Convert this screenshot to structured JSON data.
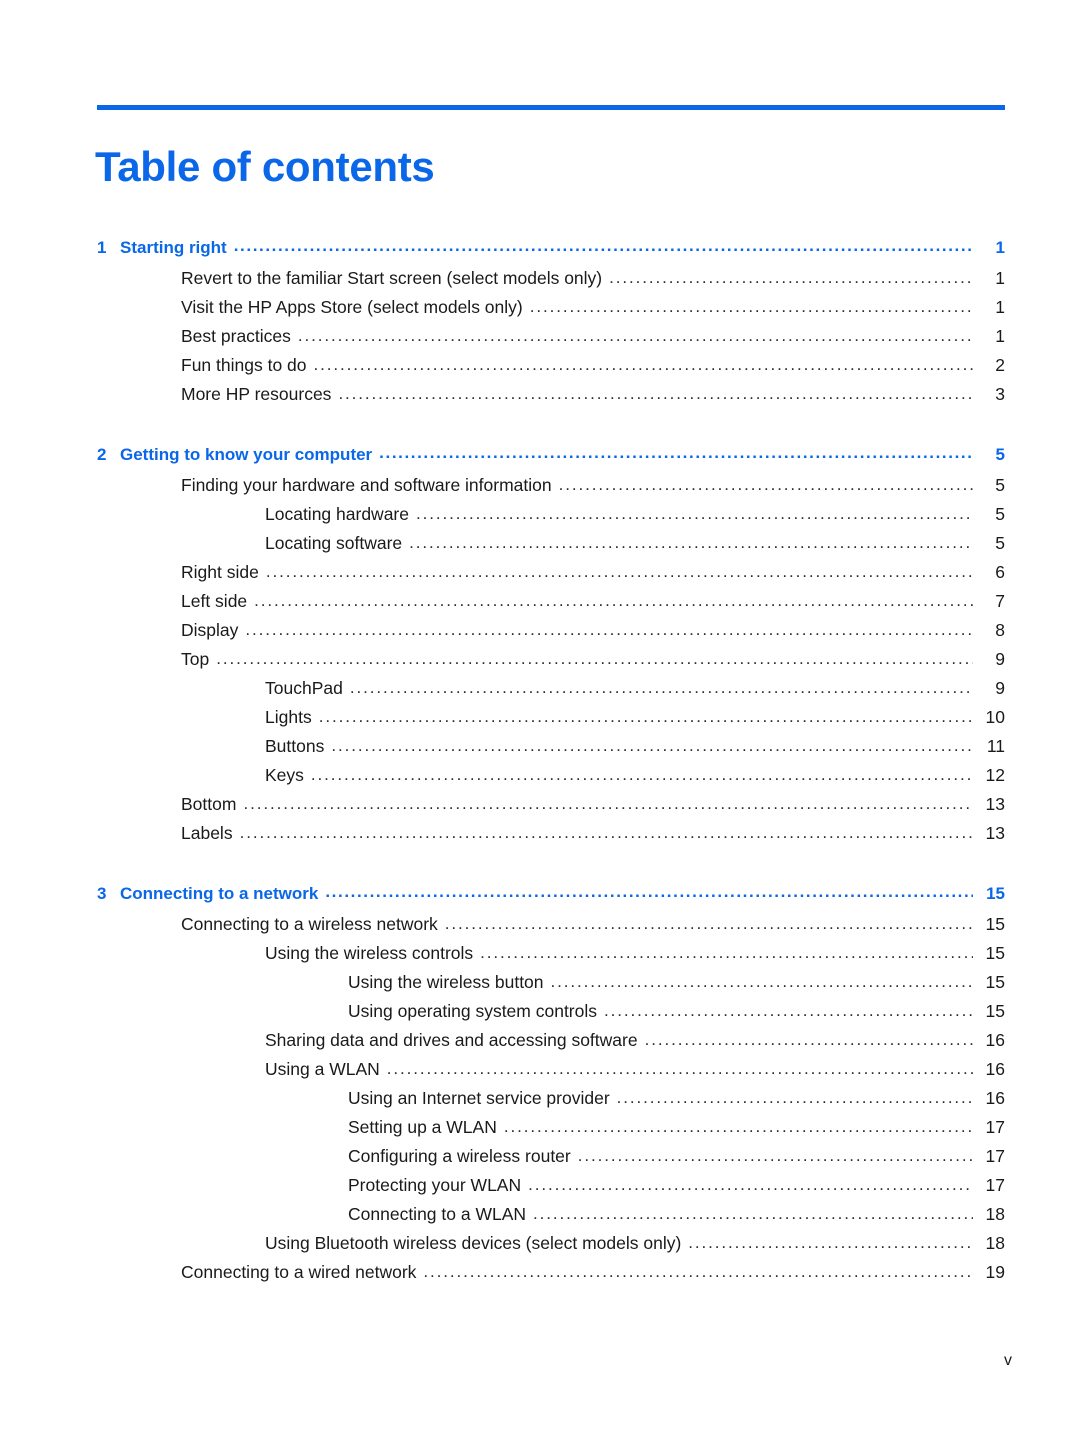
{
  "document": {
    "title": "Table of contents",
    "folio": "v",
    "accent_color": "#0a67e8",
    "text_color": "#1a1a1a",
    "leader_char": "."
  },
  "toc": {
    "entries": [
      {
        "level": "chapter",
        "number": "1",
        "label": "Starting right",
        "page": "1"
      },
      {
        "level": "1",
        "label": "Revert to the familiar Start screen (select models only)",
        "page": "1"
      },
      {
        "level": "1",
        "label": "Visit the HP Apps Store (select models only)",
        "page": "1"
      },
      {
        "level": "1",
        "label": "Best practices",
        "page": "1"
      },
      {
        "level": "1",
        "label": "Fun things to do",
        "page": "2"
      },
      {
        "level": "1",
        "label": "More HP resources",
        "page": "3"
      },
      {
        "level": "chapter",
        "number": "2",
        "label": "Getting to know your computer",
        "page": "5"
      },
      {
        "level": "1",
        "label": "Finding your hardware and software information",
        "page": "5"
      },
      {
        "level": "2",
        "label": "Locating hardware",
        "page": "5"
      },
      {
        "level": "2",
        "label": "Locating software",
        "page": "5"
      },
      {
        "level": "1",
        "label": "Right side",
        "page": "6"
      },
      {
        "level": "1",
        "label": "Left side",
        "page": "7"
      },
      {
        "level": "1",
        "label": "Display",
        "page": "8"
      },
      {
        "level": "1",
        "label": "Top",
        "page": "9"
      },
      {
        "level": "2",
        "label": "TouchPad",
        "page": "9"
      },
      {
        "level": "2",
        "label": "Lights",
        "page": "10"
      },
      {
        "level": "2",
        "label": "Buttons",
        "page": "11"
      },
      {
        "level": "2",
        "label": "Keys",
        "page": "12"
      },
      {
        "level": "1",
        "label": "Bottom",
        "page": "13"
      },
      {
        "level": "1",
        "label": "Labels",
        "page": "13"
      },
      {
        "level": "chapter",
        "number": "3",
        "label": "Connecting to a network",
        "page": "15"
      },
      {
        "level": "1",
        "label": "Connecting to a wireless network",
        "page": "15"
      },
      {
        "level": "2",
        "label": "Using the wireless controls",
        "page": "15"
      },
      {
        "level": "3",
        "label": "Using the wireless button",
        "page": "15"
      },
      {
        "level": "3",
        "label": "Using operating system controls",
        "page": "15"
      },
      {
        "level": "2",
        "label": "Sharing data and drives and accessing software",
        "page": "16"
      },
      {
        "level": "2",
        "label": "Using a WLAN",
        "page": "16"
      },
      {
        "level": "3",
        "label": "Using an Internet service provider",
        "page": "16"
      },
      {
        "level": "3",
        "label": "Setting up a WLAN",
        "page": "17"
      },
      {
        "level": "3",
        "label": "Configuring a wireless router",
        "page": "17"
      },
      {
        "level": "3",
        "label": "Protecting your WLAN",
        "page": "17"
      },
      {
        "level": "3",
        "label": "Connecting to a WLAN",
        "page": "18"
      },
      {
        "level": "2",
        "label": "Using Bluetooth wireless devices (select models only)",
        "page": "18"
      },
      {
        "level": "1",
        "label": "Connecting to a wired network",
        "page": "19"
      }
    ]
  }
}
